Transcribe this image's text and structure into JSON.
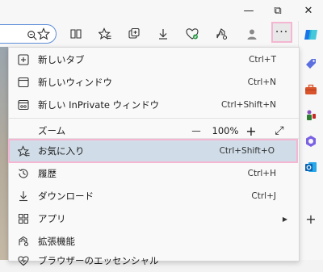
{
  "window": {
    "minimize_glyph": "—",
    "restore_glyph": "⧉",
    "close_glyph": "✕"
  },
  "toolbar": {
    "more_glyph": "···",
    "icons": [
      "read-aloud-icon",
      "favorites-star-icon",
      "tab-actions-icon",
      "collections-icon",
      "downloads-icon",
      "browser-essentials-icon",
      "extensions-icon",
      "profile-icon"
    ]
  },
  "menu": {
    "new_tab": {
      "label": "新しいタブ",
      "shortcut": "Ctrl+T"
    },
    "new_window": {
      "label": "新しいウィンドウ",
      "shortcut": "Ctrl+N"
    },
    "inprivate": {
      "label": "新しい InPrivate ウィンドウ",
      "shortcut": "Ctrl+Shift+N"
    },
    "zoom": {
      "label": "ズーム",
      "minus": "—",
      "value": "100%",
      "plus": "+",
      "fullscreen": "⤢"
    },
    "favorites": {
      "label": "お気に入り",
      "shortcut": "Ctrl+Shift+O"
    },
    "history": {
      "label": "履歴",
      "shortcut": "Ctrl+H"
    },
    "downloads": {
      "label": "ダウンロード",
      "shortcut": "Ctrl+J"
    },
    "apps": {
      "label": "アプリ",
      "arrow": "▶"
    },
    "extensions": {
      "label": "拡張機能"
    },
    "essentials": {
      "label": "ブラウザーのエッセンシャル"
    }
  },
  "sidebar": {
    "add_glyph": "+"
  },
  "colors": {
    "highlight_bg": "#d0dde8",
    "annotation_pink": "#f4b6d2",
    "address_border": "#5e8fd7"
  }
}
